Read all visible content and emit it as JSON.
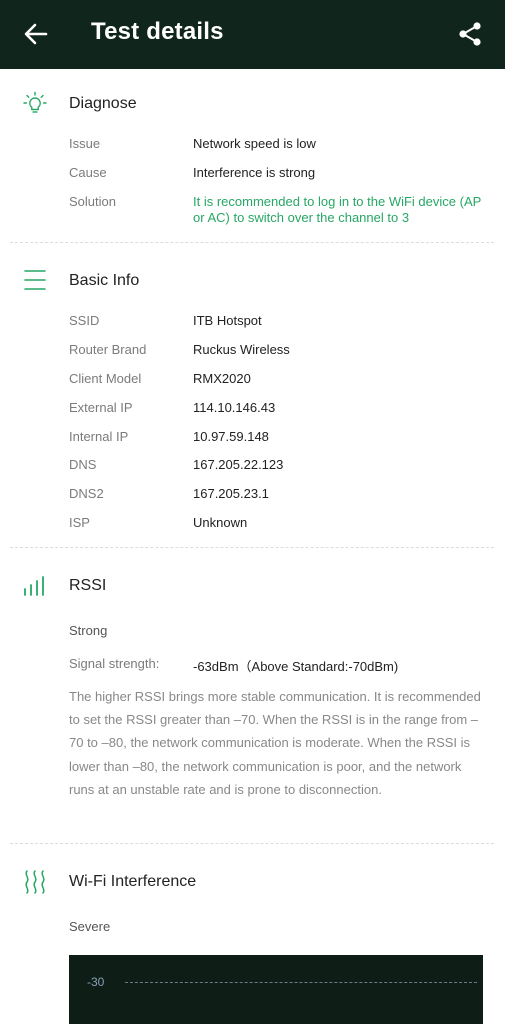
{
  "header": {
    "title": "Test details"
  },
  "diagnose": {
    "title": "Diagnose",
    "rows": [
      {
        "label": "Issue",
        "value": "Network speed is low"
      },
      {
        "label": "Cause",
        "value": "Interference is strong"
      },
      {
        "label": "Solution",
        "value": "It is recommended to log in to the WiFi device (AP or AC) to switch over the channel to 3"
      }
    ]
  },
  "basic_info": {
    "title": "Basic Info",
    "rows": [
      {
        "label": "SSID",
        "value": "ITB Hotspot"
      },
      {
        "label": "Router Brand",
        "value": "Ruckus Wireless"
      },
      {
        "label": "Client Model",
        "value": "RMX2020"
      },
      {
        "label": "External IP",
        "value": "114.10.146.43"
      },
      {
        "label": "Internal IP",
        "value": "10.97.59.148"
      },
      {
        "label": "DNS",
        "value": "167.205.22.123"
      },
      {
        "label": "DNS2",
        "value": "167.205.23.1"
      },
      {
        "label": "ISP",
        "value": "Unknown"
      }
    ]
  },
  "rssi": {
    "title": "RSSI",
    "status": "Strong",
    "strength_label": "Signal strength:",
    "strength_value": "-63dBm（Above Standard:-70dBm)",
    "description": "The higher RSSI brings more stable communication. It is recommended to set the RSSI greater than –70. When the RSSI is in the range from –70 to –80, the network communication is moderate. When the RSSI is lower than –80, the network communication is poor, and the network runs at an unstable rate and is prone to disconnection."
  },
  "wifi_interference": {
    "title": "Wi-Fi Interference",
    "status": "Severe",
    "chart_tick": "-30"
  },
  "colors": {
    "header_bg": "#10261c",
    "accent": "#27a765",
    "chart_bg": "#0e1d16"
  },
  "icons": {
    "back": "arrow-left-icon",
    "share": "share-icon",
    "diagnose": "lightbulb-icon",
    "basic_info": "list-icon",
    "rssi": "signal-bars-icon",
    "interference": "waves-icon"
  }
}
